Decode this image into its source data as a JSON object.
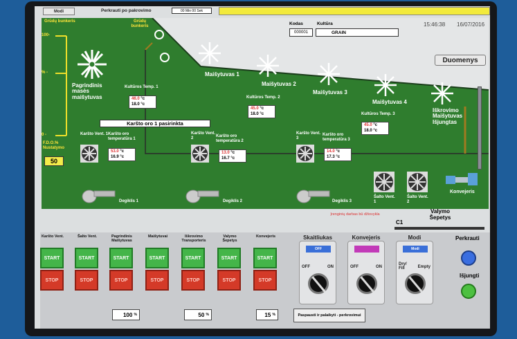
{
  "header": {
    "mode_button": "Modi",
    "prompt": "Perkrauti po pakrovimo",
    "timer": "00 Min 00 Sek",
    "kodas_label": "Kodas",
    "kodas_value": "000001",
    "kultura_label": "Kultūra",
    "kultura_value": "GRAIN",
    "time": "15:46:38",
    "date": "16/07/2016",
    "duomenys_button": "Duomenys"
  },
  "process": {
    "bunker_label": "Grūdų bunkeris",
    "bunker_center": "Grūdų bunkeris",
    "level_top": "100-",
    "level_mid": "% -",
    "level_bot": "0 -",
    "fdo_label": "F.D.O.% Nustatymo",
    "fdo_value": "50",
    "main_mixer": "Pagrindinis masės maišytuvas",
    "mixers": [
      "Maišytuvas 1",
      "Maišytuvas 2",
      "Maišytuvas 3",
      "Maišytuvas 4"
    ],
    "unloading_mixer": "Iškrovimo Maišytuvas Išjungtas",
    "culture_temp": [
      {
        "label": "Kultūros Temp. 1",
        "sp": "46.0",
        "unit": "°c",
        "pv": "18.0"
      },
      {
        "label": "Kultūros Temp. 2",
        "sp": "45.0",
        "unit": "°c",
        "pv": "18.0"
      },
      {
        "label": "Kultūros Temp. 3",
        "sp": "45.0",
        "unit": "°c",
        "pv": "18.0"
      }
    ],
    "hot_air_selected": "Karšto oro 1 pasirinkta",
    "hot_fans": [
      {
        "label": "Karšto Vent. 1",
        "temp_label": "Karšto oro temperatūra 1",
        "sp": "53.0",
        "pv": "16.9"
      },
      {
        "label": "Karšto Vent. 2",
        "temp_label": "Karšto oro temperatūra 2",
        "sp": "13.0",
        "pv": "16.7"
      },
      {
        "label": "Karšto Vent. 3",
        "temp_label": "Karšto oro temperatūra 3",
        "sp": "14.0",
        "pv": "17.3"
      }
    ],
    "burners": [
      "Degiklis 1",
      "Degiklis 2",
      "Degiklis 3"
    ],
    "cold_fans": [
      "Šalto Vent. 1",
      "Šalto Vent. 2"
    ],
    "conveyor": "Konvejeris",
    "brushes": "Valymo Šepetys",
    "c1": "C1",
    "warning": "Įrenginių darbas bū džiovykla"
  },
  "controls": {
    "start_label": "START",
    "stop_label": "STOP",
    "columns": [
      "Karšto Vent.",
      "Šalto Vent.",
      "Pagrindinis Maišytuvas",
      "Maišytuvai",
      "Iškrovimo Transporteris",
      "Valymo Šepetys",
      "Konvejeris"
    ],
    "pct1": "100",
    "pct2": "50",
    "pct3": "15",
    "pct_unit": "%",
    "hold_button": "Paspausti ir palaikyti - perkrovimui",
    "selectors": [
      {
        "title": "Skaitliukas",
        "display": "OFF",
        "left": "OFF",
        "right": "ON"
      },
      {
        "title": "Konvejeris",
        "display": "",
        "left": "OFF",
        "right": "ON"
      },
      {
        "title": "Modi",
        "display": "Modi",
        "left": "Dry/ Fill",
        "right": "Empty"
      }
    ],
    "perkrauti": "Perkrauti",
    "isjungti": "Išjungti"
  },
  "colors": {
    "green": "#2f7d2e",
    "start": "#44b549",
    "stop": "#d43a28",
    "bar": "#f2ea3c"
  }
}
